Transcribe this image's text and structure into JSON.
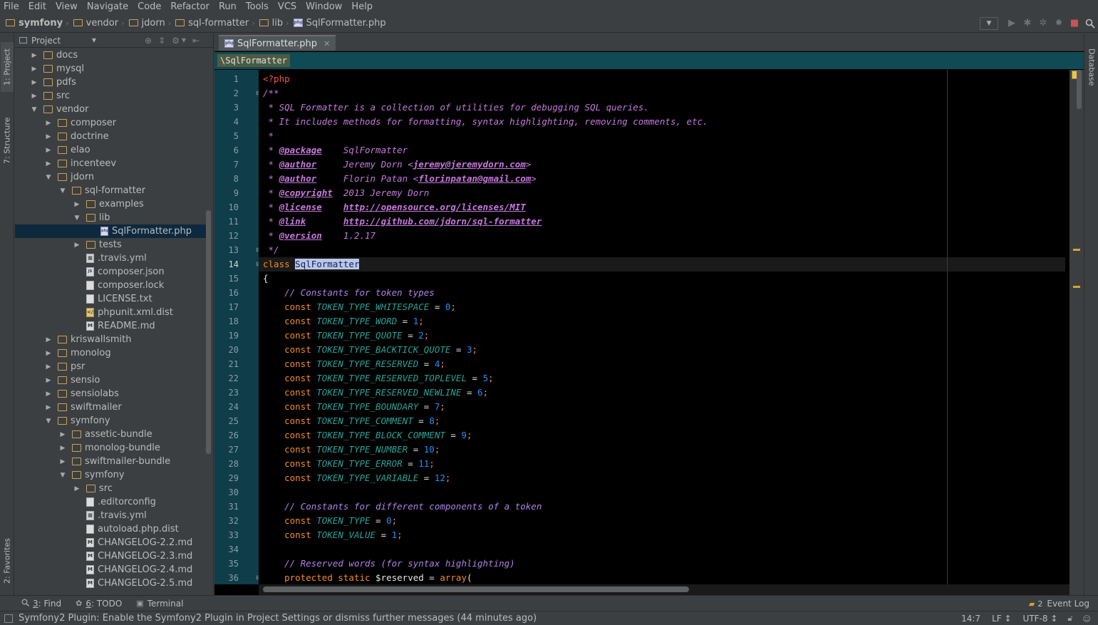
{
  "menu": [
    "File",
    "Edit",
    "View",
    "Navigate",
    "Code",
    "Refactor",
    "Run",
    "Tools",
    "VCS",
    "Window",
    "Help"
  ],
  "breadcrumbs": [
    {
      "label": "symfony",
      "icon": "folder-icon"
    },
    {
      "label": "vendor",
      "icon": "folder-icon"
    },
    {
      "label": "jdorn",
      "icon": "folder-icon"
    },
    {
      "label": "sql-formatter",
      "icon": "folder-icon"
    },
    {
      "label": "lib",
      "icon": "folder-icon"
    },
    {
      "label": "SqlFormatter.php",
      "icon": "php-file-icon"
    }
  ],
  "left_stripe": {
    "project_tab": "1: Project",
    "structure_tab": "7: Structure",
    "favorites_tab": "2: Favorites"
  },
  "right_stripe": {
    "database_tab": "Database"
  },
  "project_panel": {
    "view_selector": "Project"
  },
  "tree": [
    {
      "label": "docs",
      "type": "folder",
      "depth": 1,
      "expanded": false
    },
    {
      "label": "mysql",
      "type": "folder",
      "depth": 1,
      "expanded": false
    },
    {
      "label": "pdfs",
      "type": "folder",
      "depth": 1,
      "expanded": false
    },
    {
      "label": "src",
      "type": "folder",
      "depth": 1,
      "expanded": false
    },
    {
      "label": "vendor",
      "type": "folder",
      "depth": 1,
      "expanded": true
    },
    {
      "label": "composer",
      "type": "folder",
      "depth": 2,
      "expanded": false
    },
    {
      "label": "doctrine",
      "type": "folder",
      "depth": 2,
      "expanded": false
    },
    {
      "label": "elao",
      "type": "folder",
      "depth": 2,
      "expanded": false
    },
    {
      "label": "incenteev",
      "type": "folder",
      "depth": 2,
      "expanded": false
    },
    {
      "label": "jdorn",
      "type": "folder",
      "depth": 2,
      "expanded": true
    },
    {
      "label": "sql-formatter",
      "type": "folder",
      "depth": 3,
      "expanded": true
    },
    {
      "label": "examples",
      "type": "folder",
      "depth": 4,
      "expanded": false
    },
    {
      "label": "lib",
      "type": "folder",
      "depth": 4,
      "expanded": true
    },
    {
      "label": "SqlFormatter.php",
      "type": "php",
      "depth": 5,
      "selected": true
    },
    {
      "label": "tests",
      "type": "folder",
      "depth": 4,
      "expanded": false
    },
    {
      "label": ".travis.yml",
      "type": "grid",
      "depth": 4
    },
    {
      "label": "composer.json",
      "type": "json",
      "depth": 4
    },
    {
      "label": "composer.lock",
      "type": "text",
      "depth": 4
    },
    {
      "label": "LICENSE.txt",
      "type": "text",
      "depth": 4
    },
    {
      "label": "phpunit.xml.dist",
      "type": "xml",
      "depth": 4
    },
    {
      "label": "README.md",
      "type": "md",
      "depth": 4
    },
    {
      "label": "kriswallsmith",
      "type": "folder",
      "depth": 2,
      "expanded": false
    },
    {
      "label": "monolog",
      "type": "folder",
      "depth": 2,
      "expanded": false
    },
    {
      "label": "psr",
      "type": "folder",
      "depth": 2,
      "expanded": false
    },
    {
      "label": "sensio",
      "type": "folder",
      "depth": 2,
      "expanded": false
    },
    {
      "label": "sensiolabs",
      "type": "folder",
      "depth": 2,
      "expanded": false
    },
    {
      "label": "swiftmailer",
      "type": "folder",
      "depth": 2,
      "expanded": false
    },
    {
      "label": "symfony",
      "type": "folder",
      "depth": 2,
      "expanded": true
    },
    {
      "label": "assetic-bundle",
      "type": "folder",
      "depth": 3,
      "expanded": false
    },
    {
      "label": "monolog-bundle",
      "type": "folder",
      "depth": 3,
      "expanded": false
    },
    {
      "label": "swiftmailer-bundle",
      "type": "folder",
      "depth": 3,
      "expanded": false
    },
    {
      "label": "symfony",
      "type": "folder",
      "depth": 3,
      "expanded": true
    },
    {
      "label": "src",
      "type": "folder",
      "depth": 4,
      "expanded": false
    },
    {
      "label": ".editorconfig",
      "type": "text",
      "depth": 4
    },
    {
      "label": ".travis.yml",
      "type": "grid",
      "depth": 4
    },
    {
      "label": "autoload.php.dist",
      "type": "text",
      "depth": 4
    },
    {
      "label": "CHANGELOG-2.2.md",
      "type": "md",
      "depth": 4
    },
    {
      "label": "CHANGELOG-2.3.md",
      "type": "md",
      "depth": 4
    },
    {
      "label": "CHANGELOG-2.4.md",
      "type": "md",
      "depth": 4
    },
    {
      "label": "CHANGELOG-2.5.md",
      "type": "md",
      "depth": 4
    }
  ],
  "editor": {
    "tab_label": "SqlFormatter.php",
    "crumb": "\\SqlFormatter",
    "current_line": 14,
    "lines": [
      [
        [
          "php-open",
          "<?php"
        ]
      ],
      [
        [
          "cmt",
          "/**"
        ]
      ],
      [
        [
          "cmt",
          " * SQL Formatter is a collection of utilities for debugging SQL queries."
        ]
      ],
      [
        [
          "cmt",
          " * It includes methods for formatting, syntax highlighting, removing comments, etc."
        ]
      ],
      [
        [
          "cmt",
          " *"
        ]
      ],
      [
        [
          "cmt",
          " * "
        ],
        [
          "tag",
          "@package"
        ],
        [
          "cmt",
          "    SqlFormatter"
        ]
      ],
      [
        [
          "cmt",
          " * "
        ],
        [
          "tag",
          "@author"
        ],
        [
          "cmt",
          "     Jeremy Dorn <"
        ],
        [
          "link",
          "jeremy@jeremydorn.com"
        ],
        [
          "cmt",
          ">"
        ]
      ],
      [
        [
          "cmt",
          " * "
        ],
        [
          "tag",
          "@author"
        ],
        [
          "cmt",
          "     Florin Patan <"
        ],
        [
          "link",
          "florinpatan@gmail.com"
        ],
        [
          "cmt",
          ">"
        ]
      ],
      [
        [
          "cmt",
          " * "
        ],
        [
          "tag",
          "@copyright"
        ],
        [
          "cmt",
          "  2013 Jeremy Dorn"
        ]
      ],
      [
        [
          "cmt",
          " * "
        ],
        [
          "tag",
          "@license"
        ],
        [
          "cmt",
          "    "
        ],
        [
          "link",
          "http://opensource.org/licenses/MIT"
        ]
      ],
      [
        [
          "cmt",
          " * "
        ],
        [
          "tag",
          "@link"
        ],
        [
          "cmt",
          "       "
        ],
        [
          "link",
          "http://github.com/jdorn/sql-formatter"
        ]
      ],
      [
        [
          "cmt",
          " * "
        ],
        [
          "tag",
          "@version"
        ],
        [
          "cmt",
          "    1.2.17"
        ]
      ],
      [
        [
          "cmt",
          " */"
        ]
      ],
      [
        [
          "kw",
          "class "
        ],
        [
          "sel-name",
          "SqlFormatter"
        ]
      ],
      [
        [
          "plain",
          "{"
        ]
      ],
      [
        [
          "plain",
          "    "
        ],
        [
          "lcmt",
          "// Constants for token types"
        ]
      ],
      [
        [
          "plain",
          "    "
        ],
        [
          "kw",
          "const "
        ],
        [
          "const",
          "TOKEN_TYPE_WHITESPACE"
        ],
        [
          "op",
          " = "
        ],
        [
          "num",
          "0"
        ],
        [
          "kw",
          ";"
        ]
      ],
      [
        [
          "plain",
          "    "
        ],
        [
          "kw",
          "const "
        ],
        [
          "const",
          "TOKEN_TYPE_WORD"
        ],
        [
          "op",
          " = "
        ],
        [
          "num",
          "1"
        ],
        [
          "kw",
          ";"
        ]
      ],
      [
        [
          "plain",
          "    "
        ],
        [
          "kw",
          "const "
        ],
        [
          "const",
          "TOKEN_TYPE_QUOTE"
        ],
        [
          "op",
          " = "
        ],
        [
          "num",
          "2"
        ],
        [
          "kw",
          ";"
        ]
      ],
      [
        [
          "plain",
          "    "
        ],
        [
          "kw",
          "const "
        ],
        [
          "const",
          "TOKEN_TYPE_BACKTICK_QUOTE"
        ],
        [
          "op",
          " = "
        ],
        [
          "num",
          "3"
        ],
        [
          "kw",
          ";"
        ]
      ],
      [
        [
          "plain",
          "    "
        ],
        [
          "kw",
          "const "
        ],
        [
          "const",
          "TOKEN_TYPE_RESERVED"
        ],
        [
          "op",
          " = "
        ],
        [
          "num",
          "4"
        ],
        [
          "kw",
          ";"
        ]
      ],
      [
        [
          "plain",
          "    "
        ],
        [
          "kw",
          "const "
        ],
        [
          "const",
          "TOKEN_TYPE_RESERVED_TOPLEVEL"
        ],
        [
          "op",
          " = "
        ],
        [
          "num",
          "5"
        ],
        [
          "kw",
          ";"
        ]
      ],
      [
        [
          "plain",
          "    "
        ],
        [
          "kw",
          "const "
        ],
        [
          "const",
          "TOKEN_TYPE_RESERVED_NEWLINE"
        ],
        [
          "op",
          " = "
        ],
        [
          "num",
          "6"
        ],
        [
          "kw",
          ";"
        ]
      ],
      [
        [
          "plain",
          "    "
        ],
        [
          "kw",
          "const "
        ],
        [
          "const",
          "TOKEN_TYPE_BOUNDARY"
        ],
        [
          "op",
          " = "
        ],
        [
          "num",
          "7"
        ],
        [
          "kw",
          ";"
        ]
      ],
      [
        [
          "plain",
          "    "
        ],
        [
          "kw",
          "const "
        ],
        [
          "const",
          "TOKEN_TYPE_COMMENT"
        ],
        [
          "op",
          " = "
        ],
        [
          "num",
          "8"
        ],
        [
          "kw",
          ";"
        ]
      ],
      [
        [
          "plain",
          "    "
        ],
        [
          "kw",
          "const "
        ],
        [
          "const",
          "TOKEN_TYPE_BLOCK_COMMENT"
        ],
        [
          "op",
          " = "
        ],
        [
          "num",
          "9"
        ],
        [
          "kw",
          ";"
        ]
      ],
      [
        [
          "plain",
          "    "
        ],
        [
          "kw",
          "const "
        ],
        [
          "const",
          "TOKEN_TYPE_NUMBER"
        ],
        [
          "op",
          " = "
        ],
        [
          "num",
          "10"
        ],
        [
          "kw",
          ";"
        ]
      ],
      [
        [
          "plain",
          "    "
        ],
        [
          "kw",
          "const "
        ],
        [
          "const",
          "TOKEN_TYPE_ERROR"
        ],
        [
          "op",
          " = "
        ],
        [
          "num",
          "11"
        ],
        [
          "kw",
          ";"
        ]
      ],
      [
        [
          "plain",
          "    "
        ],
        [
          "kw",
          "const "
        ],
        [
          "const",
          "TOKEN_TYPE_VARIABLE"
        ],
        [
          "op",
          " = "
        ],
        [
          "num",
          "12"
        ],
        [
          "kw",
          ";"
        ]
      ],
      [
        [
          "plain",
          ""
        ]
      ],
      [
        [
          "plain",
          "    "
        ],
        [
          "lcmt",
          "// Constants for different components of a token"
        ]
      ],
      [
        [
          "plain",
          "    "
        ],
        [
          "kw",
          "const "
        ],
        [
          "const",
          "TOKEN_TYPE"
        ],
        [
          "op",
          " = "
        ],
        [
          "num",
          "0"
        ],
        [
          "kw",
          ";"
        ]
      ],
      [
        [
          "plain",
          "    "
        ],
        [
          "kw",
          "const "
        ],
        [
          "const",
          "TOKEN_VALUE"
        ],
        [
          "op",
          " = "
        ],
        [
          "num",
          "1"
        ],
        [
          "kw",
          ";"
        ]
      ],
      [
        [
          "plain",
          ""
        ]
      ],
      [
        [
          "plain",
          "    "
        ],
        [
          "lcmt",
          "// Reserved words (for syntax highlighting)"
        ]
      ],
      [
        [
          "plain",
          "    "
        ],
        [
          "kw",
          "protected static "
        ],
        [
          "plain",
          "$reserved"
        ],
        [
          "op",
          " = "
        ],
        [
          "func",
          "array"
        ],
        [
          "plain",
          "("
        ]
      ]
    ]
  },
  "bottom_tools": {
    "find": {
      "num": "3",
      "label": ": Find"
    },
    "todo": {
      "num": "6",
      "label": ": TODO"
    },
    "terminal": "Terminal",
    "event_log": "Event Log",
    "event_count": "2"
  },
  "status": {
    "message": "Symfony2 Plugin: Enable the Symfony2 Plugin in Project Settings or dismiss further messages (44 minutes ago)",
    "position": "14:7",
    "line_sep": "LF ↕",
    "encoding": "UTF-8 ↕"
  }
}
